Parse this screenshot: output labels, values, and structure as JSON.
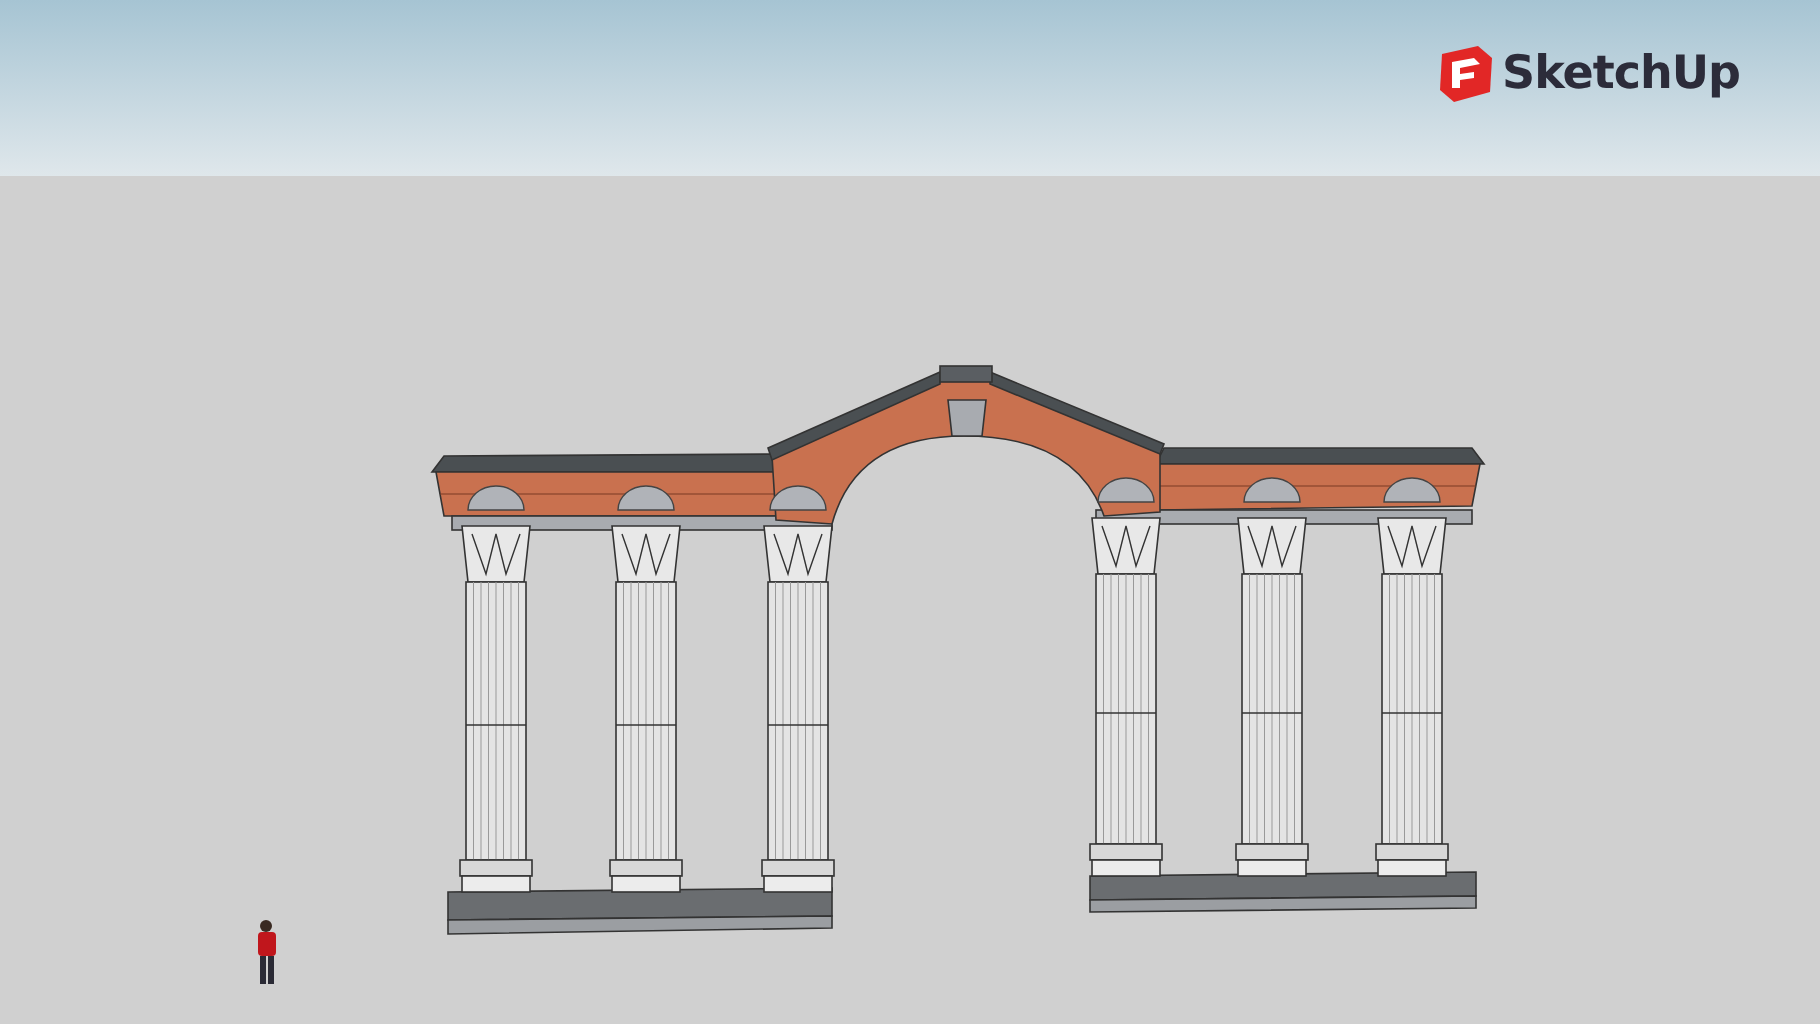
{
  "logo": {
    "text": "SketchUp"
  }
}
